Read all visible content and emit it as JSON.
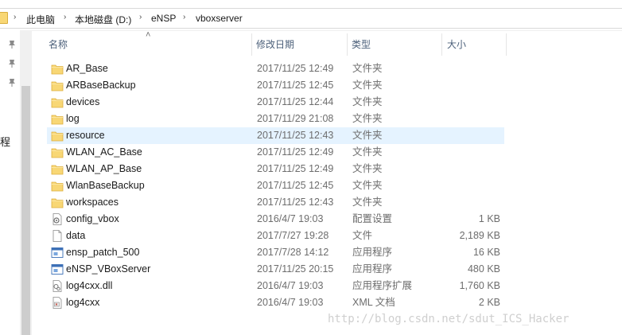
{
  "address": {
    "segments": [
      "此电脑",
      "本地磁盘 (D:)",
      "eNSP",
      "vboxserver"
    ]
  },
  "nav": {
    "partial_text": "程"
  },
  "columns": {
    "name": "名称",
    "date": "修改日期",
    "type": "类型",
    "size": "大小"
  },
  "files": [
    {
      "name": "AR_Base",
      "date": "2017/11/25 12:49",
      "type": "文件夹",
      "size": "",
      "icon": "folder-icon"
    },
    {
      "name": "ARBaseBackup",
      "date": "2017/11/25 12:45",
      "type": "文件夹",
      "size": "",
      "icon": "folder-icon"
    },
    {
      "name": "devices",
      "date": "2017/11/25 12:44",
      "type": "文件夹",
      "size": "",
      "icon": "folder-icon"
    },
    {
      "name": "log",
      "date": "2017/11/29 21:08",
      "type": "文件夹",
      "size": "",
      "icon": "folder-icon"
    },
    {
      "name": "resource",
      "date": "2017/11/25 12:43",
      "type": "文件夹",
      "size": "",
      "icon": "folder-icon",
      "selected": true
    },
    {
      "name": "WLAN_AC_Base",
      "date": "2017/11/25 12:49",
      "type": "文件夹",
      "size": "",
      "icon": "folder-icon"
    },
    {
      "name": "WLAN_AP_Base",
      "date": "2017/11/25 12:49",
      "type": "文件夹",
      "size": "",
      "icon": "folder-icon"
    },
    {
      "name": "WlanBaseBackup",
      "date": "2017/11/25 12:45",
      "type": "文件夹",
      "size": "",
      "icon": "folder-icon"
    },
    {
      "name": "workspaces",
      "date": "2017/11/25 12:43",
      "type": "文件夹",
      "size": "",
      "icon": "folder-icon"
    },
    {
      "name": "config_vbox",
      "date": "2016/4/7 19:03",
      "type": "配置设置",
      "size": "1 KB",
      "icon": "config-file-icon"
    },
    {
      "name": "data",
      "date": "2017/7/27 19:28",
      "type": "文件",
      "size": "2,189 KB",
      "icon": "file-icon"
    },
    {
      "name": "ensp_patch_500",
      "date": "2017/7/28 14:12",
      "type": "应用程序",
      "size": "16 KB",
      "icon": "application-icon"
    },
    {
      "name": "eNSP_VBoxServer",
      "date": "2017/11/25 20:15",
      "type": "应用程序",
      "size": "480 KB",
      "icon": "application-icon"
    },
    {
      "name": "log4cxx.dll",
      "date": "2016/4/7 19:03",
      "type": "应用程序扩展",
      "size": "1,760 KB",
      "icon": "dll-file-icon"
    },
    {
      "name": "log4cxx",
      "date": "2016/4/7 19:03",
      "type": "XML 文档",
      "size": "2 KB",
      "icon": "xml-file-icon"
    }
  ],
  "watermark": "http://blog.csdn.net/sdut_ICS_Hacker",
  "colors": {
    "folder": "#f8d775",
    "selected_row": "#e5f3ff",
    "header_text": "#4c607a"
  }
}
